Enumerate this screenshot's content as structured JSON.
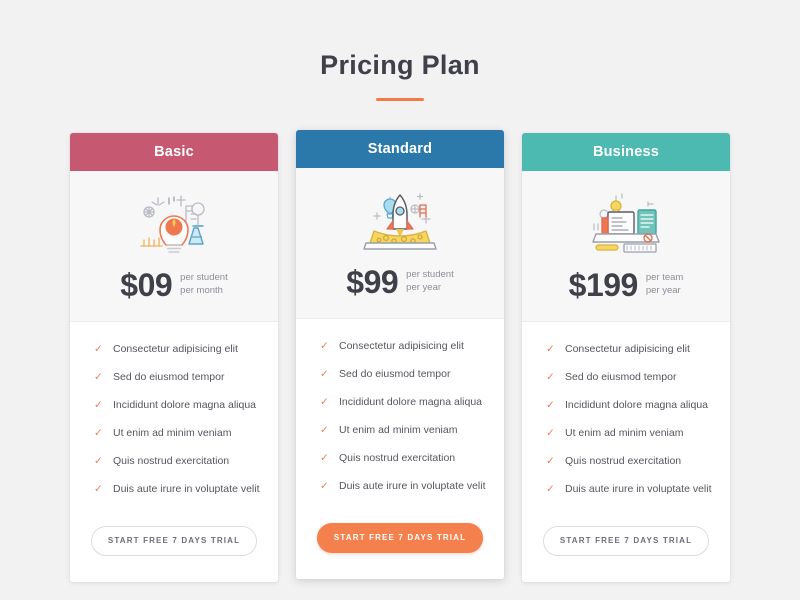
{
  "header": {
    "title": "Pricing Plan"
  },
  "colors": {
    "accent": "#f4794a",
    "page_background": "#f2f2f2",
    "basic_header": "#c75872",
    "standard_header": "#2b79ab",
    "business_header": "#4cbab0",
    "check": "#ef7e5a",
    "price_text": "#3f4049"
  },
  "plans": [
    {
      "name": "Basic",
      "header_color": "#c75872",
      "illustration": "lightbulb-idea-icon",
      "price": "$09",
      "unit_line1": "per student",
      "unit_line2": "per month",
      "featured": false,
      "features": [
        "Consectetur adipisicing elit",
        "Sed do eiusmod tempor",
        "Incididunt dolore magna aliqua",
        "Ut enim ad minim veniam",
        "Quis nostrud exercitation",
        "Duis aute irure in voluptate velit"
      ],
      "cta_label": "START FREE 7 DAYS TRIAL"
    },
    {
      "name": "Standard",
      "header_color": "#2b79ab",
      "illustration": "rocket-launch-laptop-icon",
      "price": "$99",
      "unit_line1": "per student",
      "unit_line2": "per year",
      "featured": true,
      "features": [
        "Consectetur adipisicing elit",
        "Sed do eiusmod tempor",
        "Incididunt dolore magna aliqua",
        "Ut enim ad minim veniam",
        "Quis nostrud exercitation",
        "Duis aute irure in voluptate velit"
      ],
      "cta_label": "START FREE 7 DAYS TRIAL"
    },
    {
      "name": "Business",
      "header_color": "#4cbab0",
      "illustration": "desk-workstation-icon",
      "price": "$199",
      "unit_line1": "per team",
      "unit_line2": "per year",
      "featured": false,
      "features": [
        "Consectetur adipisicing elit",
        "Sed do eiusmod tempor",
        "Incididunt dolore magna aliqua",
        "Ut enim ad minim veniam",
        "Quis nostrud exercitation",
        "Duis aute irure in voluptate velit"
      ],
      "cta_label": "START FREE 7 DAYS TRIAL"
    }
  ],
  "icons": {
    "check": "✓"
  }
}
